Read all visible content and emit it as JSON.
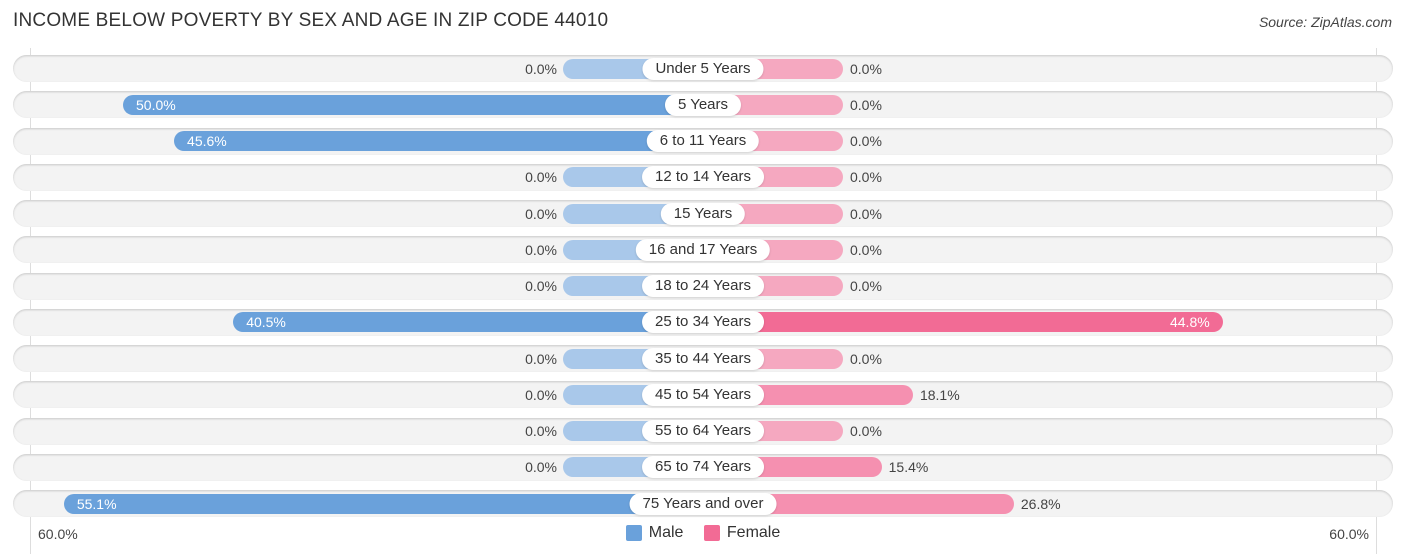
{
  "header": {
    "title": "INCOME BELOW POVERTY BY SEX AND AGE IN ZIP CODE 44010",
    "source": "Source: ZipAtlas.com"
  },
  "colors": {
    "male": "#6aa1db",
    "male_zero": "#a9c8ea",
    "female": "#f26b95",
    "female_zero": "#f5a8c0"
  },
  "chart_data": {
    "type": "bar",
    "orientation": "horizontal-diverging",
    "title": "INCOME BELOW POVERTY BY SEX AND AGE IN ZIP CODE 44010",
    "categories": [
      "Under 5 Years",
      "5 Years",
      "6 to 11 Years",
      "12 to 14 Years",
      "15 Years",
      "16 and 17 Years",
      "18 to 24 Years",
      "25 to 34 Years",
      "35 to 44 Years",
      "45 to 54 Years",
      "55 to 64 Years",
      "65 to 74 Years",
      "75 Years and over"
    ],
    "series": [
      {
        "name": "Male",
        "values": [
          0.0,
          50.0,
          45.6,
          0.0,
          0.0,
          0.0,
          0.0,
          40.5,
          0.0,
          0.0,
          0.0,
          0.0,
          55.1
        ],
        "labels": [
          "0.0%",
          "50.0%",
          "45.6%",
          "0.0%",
          "0.0%",
          "0.0%",
          "0.0%",
          "40.5%",
          "0.0%",
          "0.0%",
          "0.0%",
          "0.0%",
          "55.1%"
        ]
      },
      {
        "name": "Female",
        "values": [
          0.0,
          0.0,
          0.0,
          0.0,
          0.0,
          0.0,
          0.0,
          44.8,
          0.0,
          18.1,
          0.0,
          15.4,
          26.8
        ],
        "labels": [
          "0.0%",
          "0.0%",
          "0.0%",
          "0.0%",
          "0.0%",
          "0.0%",
          "0.0%",
          "44.8%",
          "0.0%",
          "18.1%",
          "0.0%",
          "15.4%",
          "26.8%"
        ]
      }
    ],
    "xlim": [
      -60,
      60
    ],
    "axis_labels": {
      "left": "60.0%",
      "right": "60.0%"
    },
    "legend": [
      "Male",
      "Female"
    ],
    "legend_position": "bottom-center",
    "unit": "%"
  }
}
